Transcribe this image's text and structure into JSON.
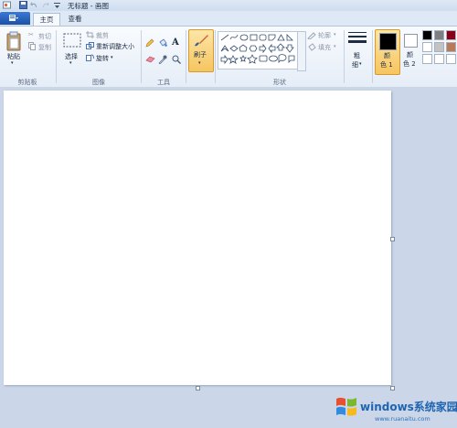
{
  "window": {
    "title": "无标题 - 画图"
  },
  "tabs": [
    {
      "label": "主页",
      "active": true
    },
    {
      "label": "查看",
      "active": false
    }
  ],
  "clipboard": {
    "paste": "粘贴",
    "cut": "剪切",
    "copy": "复制",
    "group": "剪贴板"
  },
  "image": {
    "select": "选择",
    "crop": "裁剪",
    "resize": "重新调整大小",
    "rotate": "旋转",
    "group": "图像"
  },
  "tools": {
    "group": "工具"
  },
  "brushes": {
    "label": "刷子"
  },
  "shapes": {
    "outline": "轮廓",
    "fill": "填充",
    "group": "形状"
  },
  "size": {
    "label_top": "粗",
    "label_bottom": "细"
  },
  "colors": {
    "color1_top": "颜",
    "color1_bottom": "色 1",
    "color2_top": "颜",
    "color2_bottom": "色 2",
    "color1_value": "#000000",
    "color2_value": "#ffffff",
    "palette": [
      "#000000",
      "#7f7f7f",
      "#880015",
      "#ffffff",
      "#c3c3c3",
      "#b97a57",
      "#ffffff",
      "#ffffff",
      "#ffffff"
    ]
  },
  "watermark": {
    "brand": "windows系统家园",
    "url": "www.ruanaitu.com"
  }
}
